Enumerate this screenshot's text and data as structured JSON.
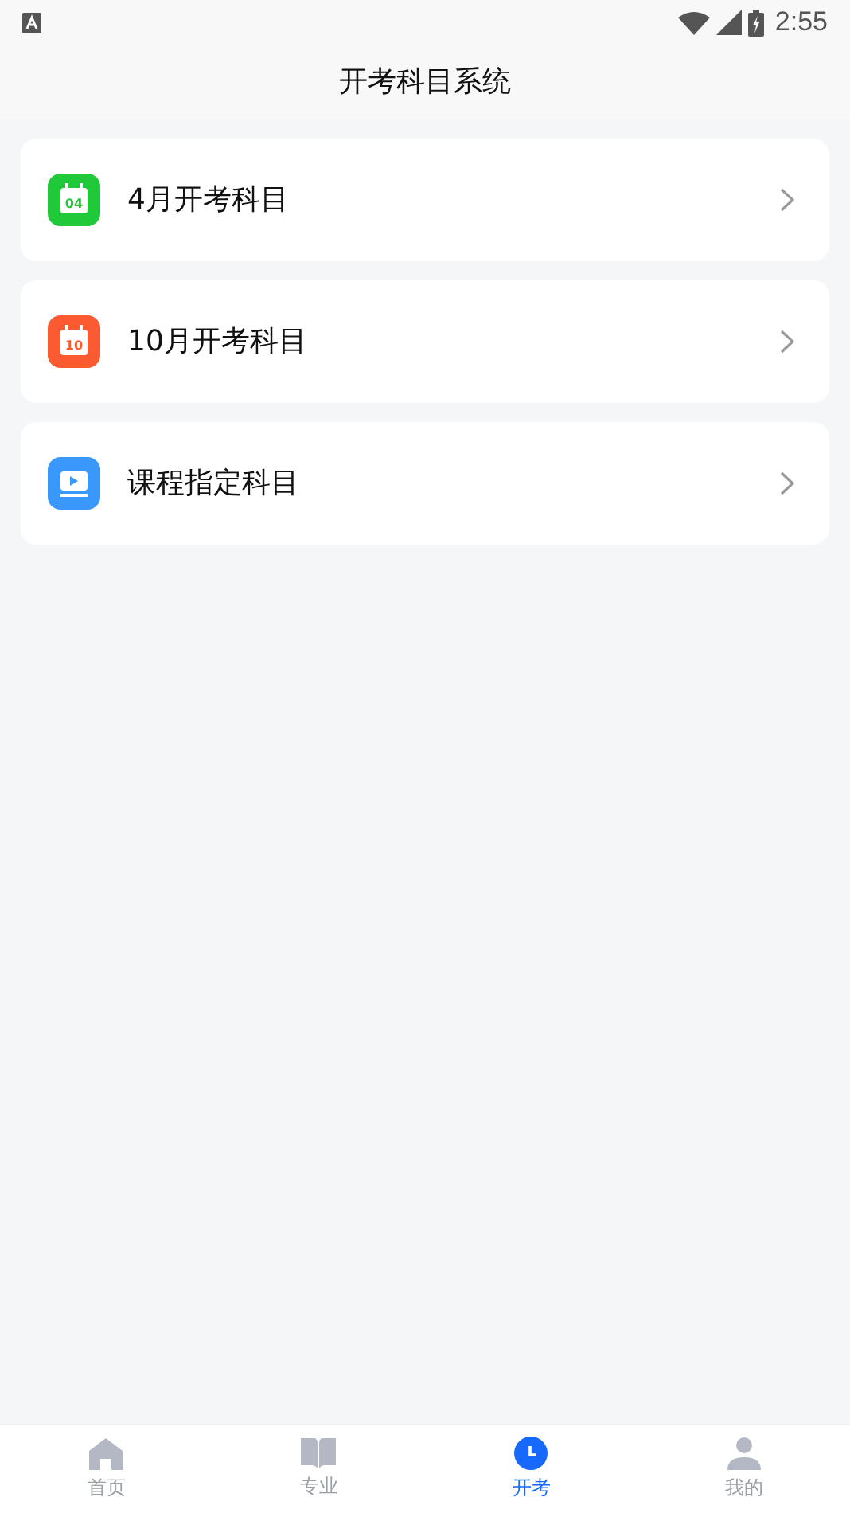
{
  "status_bar": {
    "time": "2:55"
  },
  "header": {
    "title": "开考科目系统"
  },
  "items": [
    {
      "kind": "calendar",
      "color": "#1fc93a",
      "icon_text": "04",
      "label": "4月开考科目"
    },
    {
      "kind": "calendar",
      "color": "#fc5a30",
      "icon_text": "10",
      "label": "10月开考科目"
    },
    {
      "kind": "video",
      "color": "#3a97fb",
      "label": "课程指定科目"
    }
  ],
  "tab_bar": [
    {
      "kind": "home",
      "label": "首页",
      "selected": false
    },
    {
      "kind": "book",
      "label": "专业",
      "selected": false
    },
    {
      "kind": "clock",
      "label": "开考",
      "selected": true
    },
    {
      "kind": "user",
      "label": "我的",
      "selected": false
    }
  ]
}
